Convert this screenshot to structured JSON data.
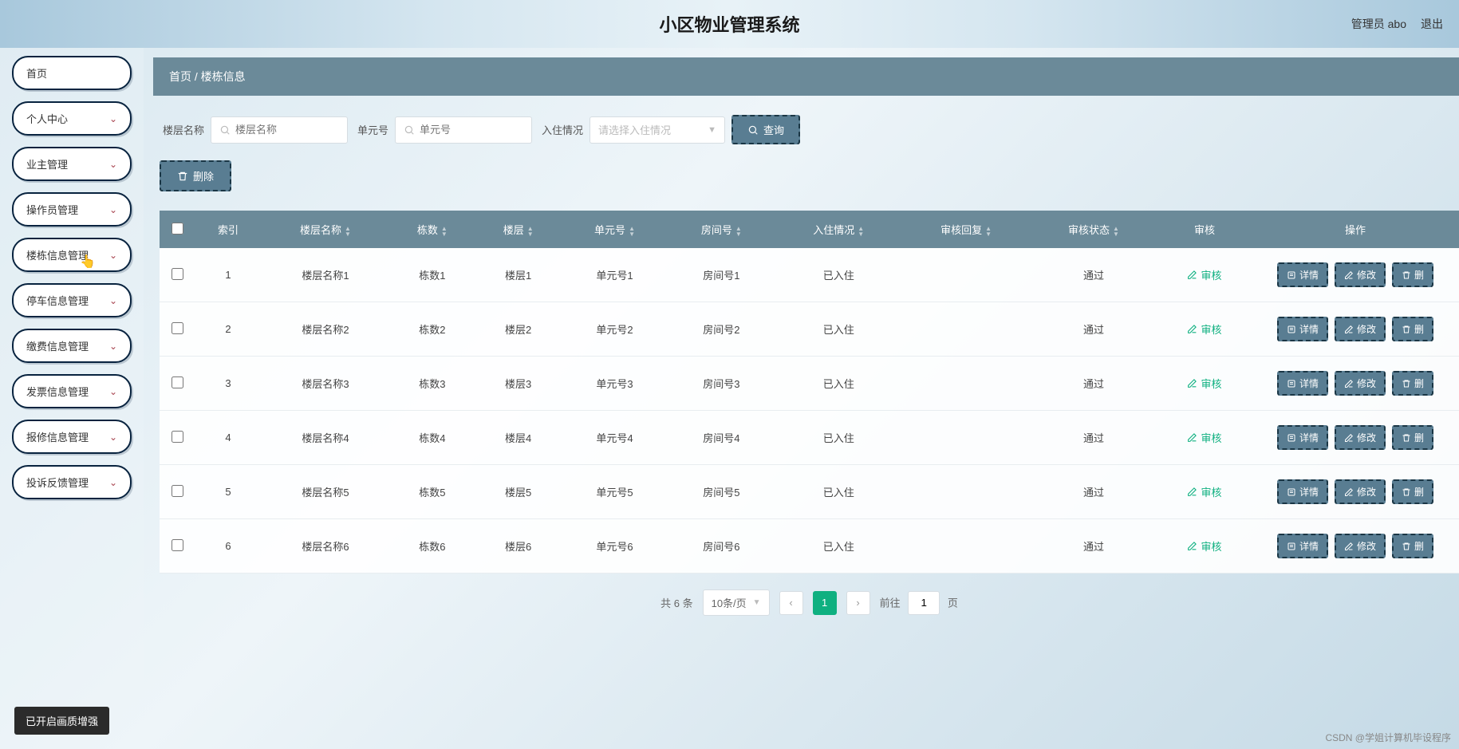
{
  "header": {
    "title": "小区物业管理系统",
    "user_label": "管理员 abo",
    "logout": "退出"
  },
  "sidebar": {
    "items": [
      {
        "label": "首页",
        "expandable": false
      },
      {
        "label": "个人中心",
        "expandable": true
      },
      {
        "label": "业主管理",
        "expandable": true
      },
      {
        "label": "操作员管理",
        "expandable": true
      },
      {
        "label": "楼栋信息管理",
        "expandable": true
      },
      {
        "label": "停车信息管理",
        "expandable": true
      },
      {
        "label": "缴费信息管理",
        "expandable": true
      },
      {
        "label": "发票信息管理",
        "expandable": true
      },
      {
        "label": "报修信息管理",
        "expandable": true
      },
      {
        "label": "投诉反馈管理",
        "expandable": true
      }
    ]
  },
  "breadcrumb": {
    "home": "首页",
    "sep": "/",
    "current": "楼栋信息"
  },
  "filters": {
    "floor_label": "楼层名称",
    "floor_placeholder": "楼层名称",
    "unit_label": "单元号",
    "unit_placeholder": "单元号",
    "status_label": "入住情况",
    "status_placeholder": "请选择入住情况",
    "query_btn": "查询",
    "delete_btn": "删除"
  },
  "table": {
    "headers": {
      "index": "索引",
      "floor_name": "楼层名称",
      "building": "栋数",
      "floor": "楼层",
      "unit": "单元号",
      "room": "房间号",
      "status": "入住情况",
      "reply": "审核回复",
      "audit_status": "审核状态",
      "audit": "审核",
      "action": "操作"
    },
    "audit_link": "审核",
    "actions": {
      "detail": "详情",
      "edit": "修改",
      "delete": "删"
    },
    "rows": [
      {
        "idx": "1",
        "floor_name": "楼层名称1",
        "building": "栋数1",
        "floor": "楼层1",
        "unit": "单元号1",
        "room": "房间号1",
        "status": "已入住",
        "reply": "",
        "audit_status": "通过"
      },
      {
        "idx": "2",
        "floor_name": "楼层名称2",
        "building": "栋数2",
        "floor": "楼层2",
        "unit": "单元号2",
        "room": "房间号2",
        "status": "已入住",
        "reply": "",
        "audit_status": "通过"
      },
      {
        "idx": "3",
        "floor_name": "楼层名称3",
        "building": "栋数3",
        "floor": "楼层3",
        "unit": "单元号3",
        "room": "房间号3",
        "status": "已入住",
        "reply": "",
        "audit_status": "通过"
      },
      {
        "idx": "4",
        "floor_name": "楼层名称4",
        "building": "栋数4",
        "floor": "楼层4",
        "unit": "单元号4",
        "room": "房间号4",
        "status": "已入住",
        "reply": "",
        "audit_status": "通过"
      },
      {
        "idx": "5",
        "floor_name": "楼层名称5",
        "building": "栋数5",
        "floor": "楼层5",
        "unit": "单元号5",
        "room": "房间号5",
        "status": "已入住",
        "reply": "",
        "audit_status": "通过"
      },
      {
        "idx": "6",
        "floor_name": "楼层名称6",
        "building": "栋数6",
        "floor": "楼层6",
        "unit": "单元号6",
        "room": "房间号6",
        "status": "已入住",
        "reply": "",
        "audit_status": "通过"
      }
    ]
  },
  "pagination": {
    "total": "共 6 条",
    "page_size": "10条/页",
    "current": "1",
    "jump_prefix": "前往",
    "jump_value": "1",
    "jump_suffix": "页"
  },
  "toast": "已开启画质增强",
  "watermark": "CSDN @学姐计算机毕设程序"
}
